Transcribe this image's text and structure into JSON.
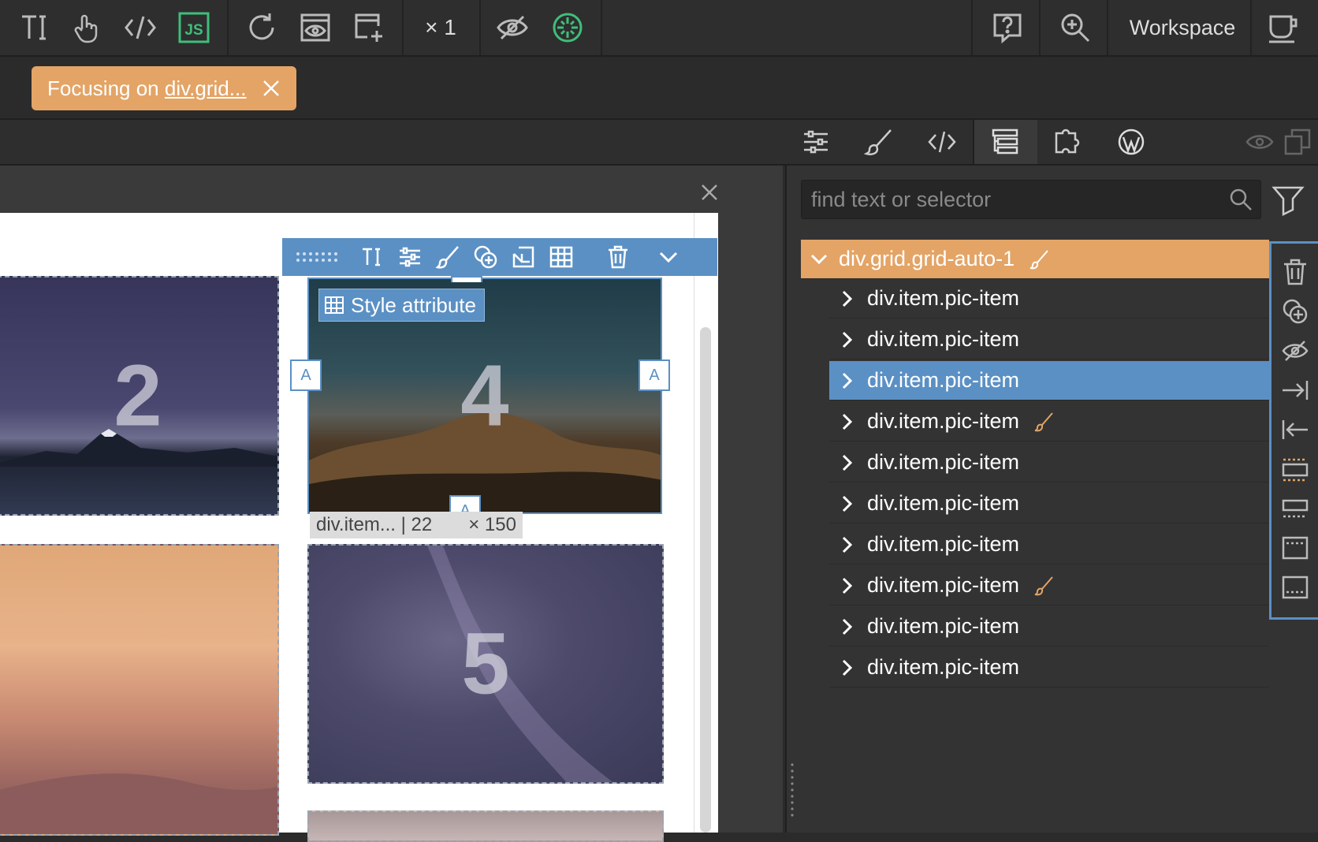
{
  "toolbar": {
    "zoom_label": "× 1",
    "workspace_label": "Workspace",
    "icons": [
      "text-cursor-icon",
      "hand-pointer-icon",
      "code-icon",
      "javascript-icon",
      "refresh-icon",
      "preview-icon",
      "add-frame-icon",
      "eye-off-icon",
      "target-icon",
      "help-icon",
      "zoom-in-icon",
      "cup-icon"
    ],
    "accent_green": "#3ebf7a"
  },
  "focus": {
    "prefix": "Focusing on ",
    "target": "div.grid..."
  },
  "panel_tabs": [
    "properties-tab",
    "style-tab",
    "code-tab",
    "tree-tab",
    "plugins-tab",
    "wordpress-tab"
  ],
  "canvas": {
    "cells": [
      {
        "number": "2"
      },
      {
        "number": "4"
      },
      {
        "number": "5"
      }
    ],
    "style_attribute_label": "Style attribute",
    "handle_label": "A",
    "size_label": "div.item... | 22",
    "size_label_rest": "× 150"
  },
  "search": {
    "placeholder": "find text or selector"
  },
  "tree": {
    "root": "div.grid.grid-auto-1",
    "items": [
      {
        "label": "div.item.pic-item",
        "selected": false,
        "styled": false
      },
      {
        "label": "div.item.pic-item",
        "selected": false,
        "styled": false
      },
      {
        "label": "div.item.pic-item",
        "selected": true,
        "styled": false
      },
      {
        "label": "div.item.pic-item",
        "selected": false,
        "styled": true
      },
      {
        "label": "div.item.pic-item",
        "selected": false,
        "styled": false
      },
      {
        "label": "div.item.pic-item",
        "selected": false,
        "styled": false
      },
      {
        "label": "div.item.pic-item",
        "selected": false,
        "styled": false
      },
      {
        "label": "div.item.pic-item",
        "selected": false,
        "styled": true
      },
      {
        "label": "div.item.pic-item",
        "selected": false,
        "styled": false
      },
      {
        "label": "div.item.pic-item",
        "selected": false,
        "styled": false
      }
    ]
  },
  "colors": {
    "orange": "#e3a466",
    "blue": "#5b90c4"
  }
}
